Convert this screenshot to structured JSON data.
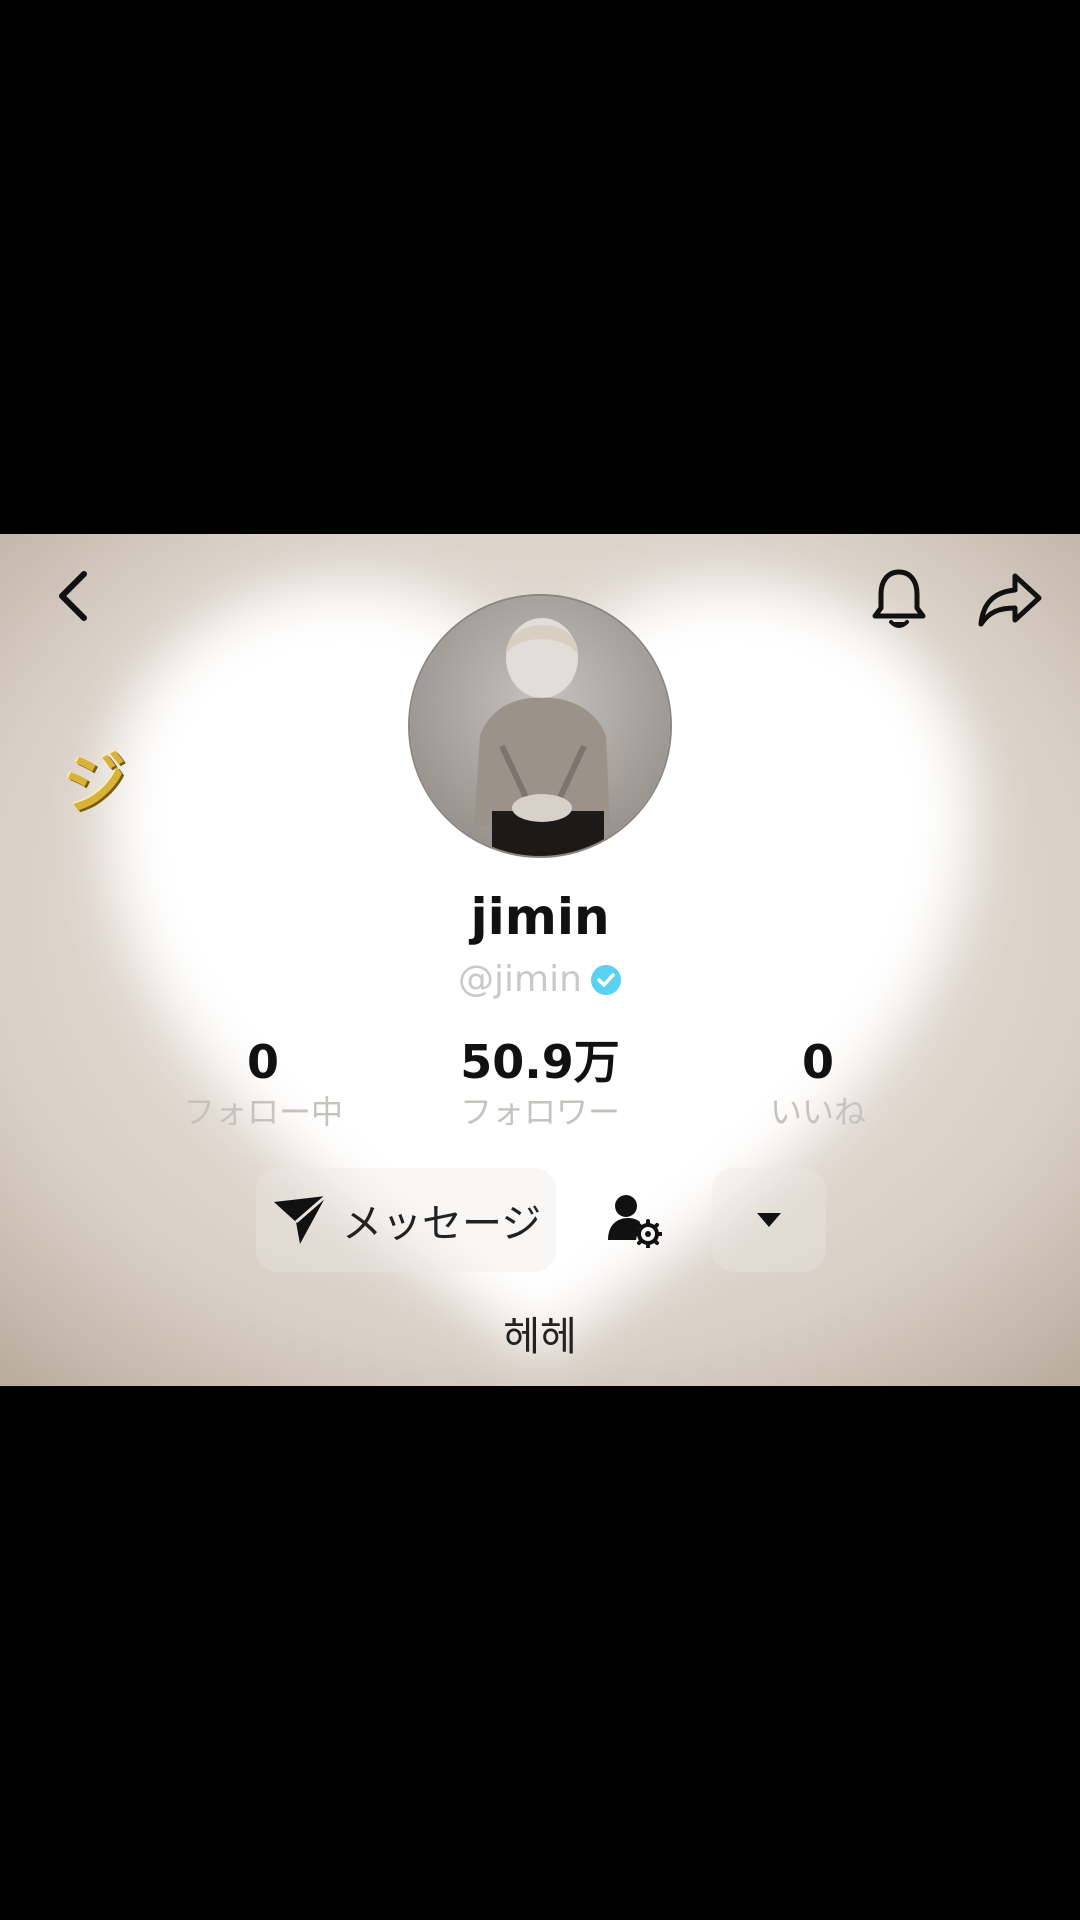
{
  "profile": {
    "display_name": "jimin",
    "handle": "@jimin",
    "verified": true,
    "bio": "헤헤"
  },
  "stats": {
    "following_count": "0",
    "following_label": "フォロー中",
    "followers_count": "50.9万",
    "followers_label": "フォロワー",
    "likes_count": "0",
    "likes_label": "いいね"
  },
  "actions": {
    "message_label": "メッセージ"
  },
  "sticker": {
    "text": "ジ"
  },
  "icons": {
    "back": "chevron-left-icon",
    "bell": "bell-icon",
    "share": "share-arrow-icon",
    "message": "send-icon",
    "friend_settings": "person-gear-icon",
    "more": "caret-down-icon"
  },
  "colors": {
    "verified_badge": "#5ad1f0",
    "letterbox": "#000000"
  }
}
